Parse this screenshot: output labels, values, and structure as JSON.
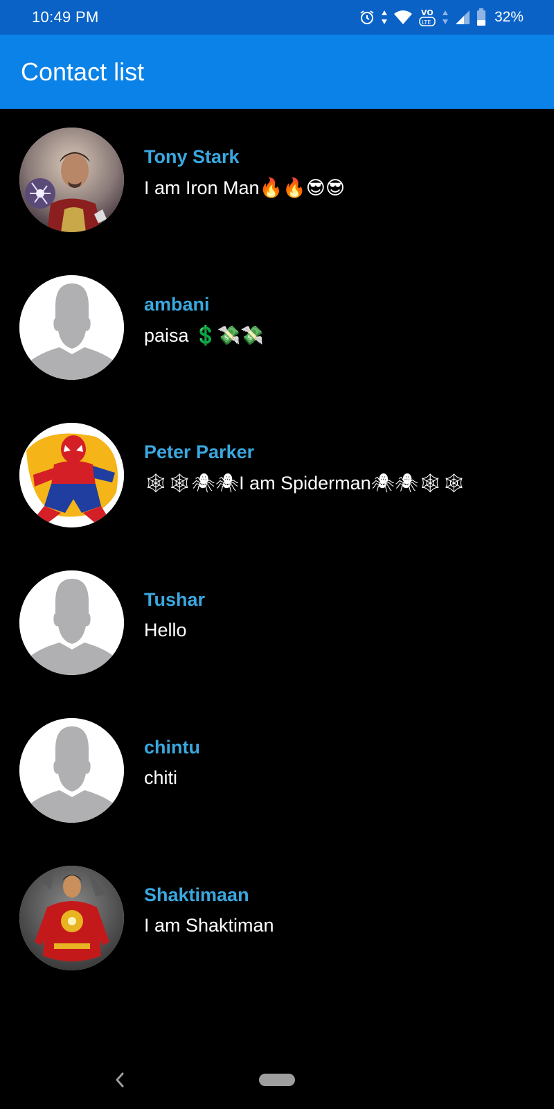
{
  "status_bar": {
    "time": "10:49 PM",
    "battery": "32%",
    "icons": [
      "alarm-icon",
      "data-arrows-icon",
      "wifi-icon",
      "volte-icon",
      "signal-icon",
      "battery-icon"
    ],
    "background": "#0a62c6"
  },
  "app_bar": {
    "title": "Contact list",
    "background": "#0b82e8"
  },
  "contacts": [
    {
      "name": "Tony Stark",
      "status": "I am Iron Man🔥🔥😎😎",
      "avatar": "iron-man-photo"
    },
    {
      "name": "ambani",
      "status": "paisa 💲💸💸",
      "avatar": "default-person"
    },
    {
      "name": "Peter Parker",
      "status": "🕸🕸🕷🕷I am Spiderman🕷🕷🕸🕸",
      "avatar": "spiderman-photo"
    },
    {
      "name": "Tushar",
      "status": "Hello",
      "avatar": "default-person"
    },
    {
      "name": "chintu",
      "status": "chiti",
      "avatar": "default-person"
    },
    {
      "name": "Shaktimaan",
      "status": "I am Shaktiman",
      "avatar": "shaktimaan-photo"
    }
  ],
  "colors": {
    "name_text": "#3aa8df",
    "status_text": "#ffffff",
    "list_background": "#000000"
  },
  "nav_bar": {
    "icons": [
      "back-icon",
      "home-pill-icon"
    ]
  }
}
